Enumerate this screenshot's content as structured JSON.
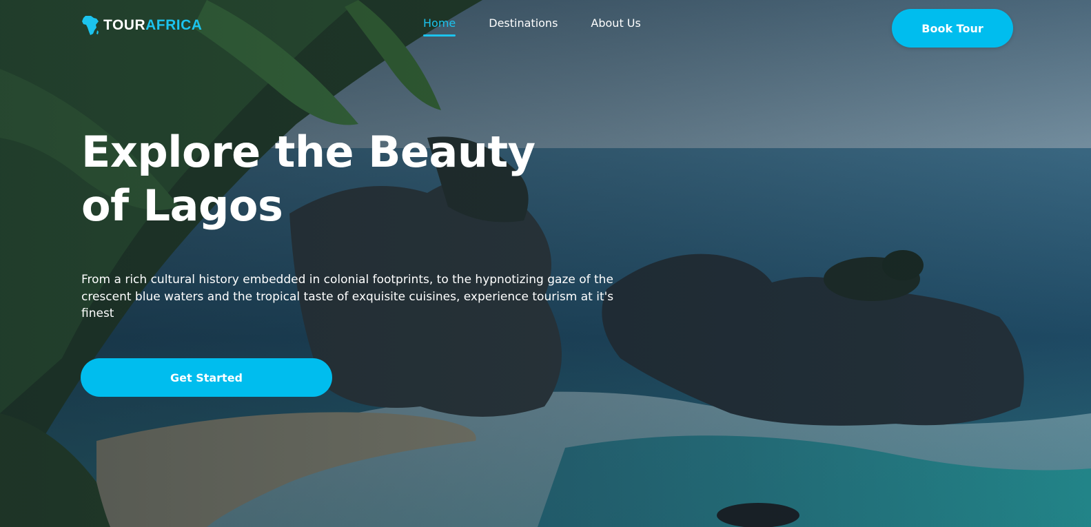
{
  "brand": {
    "name_part1": "TOUR",
    "name_part2": "AFRICA",
    "logo_icon": "africa-map-icon",
    "accent_color": "#1cc3ee"
  },
  "nav": {
    "items": [
      {
        "label": "Home",
        "active": true
      },
      {
        "label": "Destinations",
        "active": false
      },
      {
        "label": "About Us",
        "active": false
      }
    ]
  },
  "header": {
    "book_label": "Book Tour"
  },
  "hero": {
    "title": "Explore the Beauty of Lagos",
    "description": "From a rich cultural history embedded in colonial footprints, to the hypnotizing gaze of the crescent blue waters and the tropical taste of exquisite cuisines, experience tourism at it's finest",
    "cta_label": "Get Started",
    "background": "coastal-cliffs-ocean-palm-photo"
  },
  "colors": {
    "button": "#00bdee",
    "text": "#ffffff"
  }
}
